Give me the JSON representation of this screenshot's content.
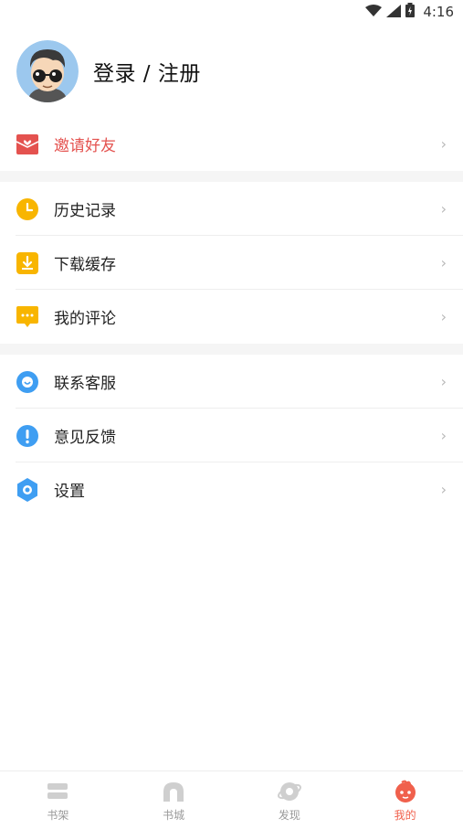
{
  "status_bar": {
    "time": "4:16"
  },
  "profile": {
    "name": "登录 / 注册"
  },
  "menu": {
    "invite": {
      "label": "邀请好友",
      "color": "#e4524f"
    },
    "history": {
      "label": "历史记录"
    },
    "download": {
      "label": "下载缓存"
    },
    "comments": {
      "label": "我的评论"
    },
    "service": {
      "label": "联系客服"
    },
    "feedback": {
      "label": "意见反馈"
    },
    "settings": {
      "label": "设置"
    }
  },
  "tabbar": {
    "bookshelf": {
      "label": "书架"
    },
    "bookstore": {
      "label": "书城"
    },
    "discover": {
      "label": "发现"
    },
    "mine": {
      "label": "我的",
      "active": true,
      "accent": "#f0604c"
    }
  }
}
